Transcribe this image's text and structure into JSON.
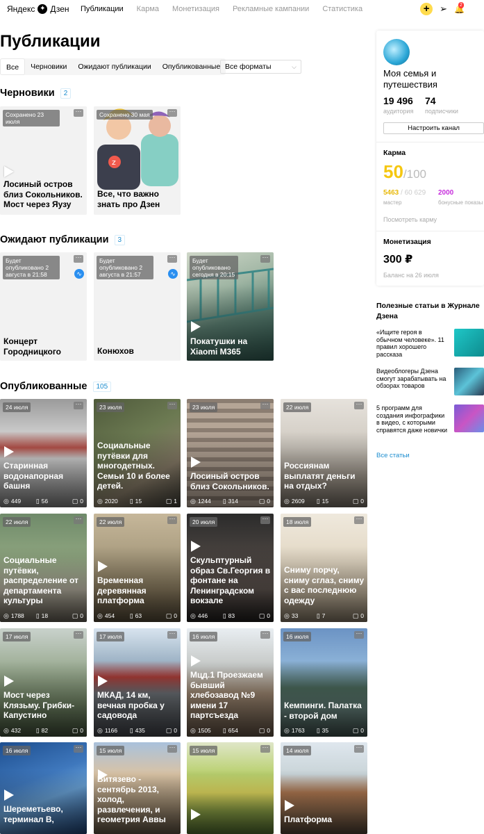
{
  "header": {
    "logo_text": "Яндекс",
    "logo_brand": "Дзен",
    "nav": [
      "Публикации",
      "Карма",
      "Монетизация",
      "Рекламные кампании",
      "Статистика"
    ],
    "add_label": "+",
    "notifications_count": "2"
  },
  "page_title": "Публикации",
  "filters": {
    "tabs": [
      "Все",
      "Черновики",
      "Ожидают публикации",
      "Опубликованные"
    ],
    "format_select": "Все форматы"
  },
  "sections": {
    "drafts": {
      "title": "Черновики",
      "count": "2"
    },
    "scheduled": {
      "title": "Ожидают публикации",
      "count": "3"
    },
    "published": {
      "title": "Опубликованные",
      "count": "105"
    }
  },
  "drafts": [
    {
      "badge": "Сохранено 23 июля",
      "title": "Лосиный остров близ Сокольников. Мост через Яузу"
    },
    {
      "badge": "Сохранено 30 мая",
      "title": "Все, что важно знать про Дзен"
    }
  ],
  "scheduled": [
    {
      "badge": "Будет опубликовано 2 августа в 21:58",
      "title": "Концерт Городницкого"
    },
    {
      "badge": "Будет опубликовано 2 августа в 21:57",
      "title": "Конюхов"
    },
    {
      "badge": "Будет опубликовано сегодня в 20:15",
      "title": "Покатушки на Xiaomi M365"
    }
  ],
  "published": [
    {
      "date": "24 июля",
      "title": "Старинная водонапорная башня",
      "views": "449",
      "reads": "56",
      "comments": "0"
    },
    {
      "date": "23 июля",
      "title": "Социальные путёвки для многодетных. Семьи 10 и более детей.",
      "views": "2020",
      "reads": "15",
      "comments": "1"
    },
    {
      "date": "23 июля",
      "title": "Лосиный остров близ Сокольников.",
      "views": "1244",
      "reads": "314",
      "comments": "0"
    },
    {
      "date": "22 июля",
      "title": "Россиянам выплатят деньги на отдых?",
      "views": "2609",
      "reads": "15",
      "comments": "0"
    },
    {
      "date": "22 июля",
      "title": "Социальные путёвки, распределение от департамента культуры",
      "views": "1788",
      "reads": "18",
      "comments": "0"
    },
    {
      "date": "22 июля",
      "title": "Временная деревянная платформа",
      "views": "454",
      "reads": "63",
      "comments": "0"
    },
    {
      "date": "20 июля",
      "title": "Скульптурный образ Св.Георгия в фонтане на Ленинградском вокзале",
      "views": "446",
      "reads": "83",
      "comments": "0"
    },
    {
      "date": "18 июля",
      "title": "Сниму порчу, сниму сглаз, сниму с вас последнюю одежду",
      "views": "33",
      "reads": "7",
      "comments": "0"
    },
    {
      "date": "17 июля",
      "title": "Мост через Клязьму. Грибки-Капустино",
      "views": "432",
      "reads": "82",
      "comments": "0"
    },
    {
      "date": "17 июля",
      "title": "МКАД, 14 км, вечная пробка у садовода",
      "views": "1166",
      "reads": "435",
      "comments": "0"
    },
    {
      "date": "16 июля",
      "title": "Мцд.1 Проезжаем бывший хлебозавод №9 имени 17 партсъезда",
      "views": "1505",
      "reads": "654",
      "comments": "0"
    },
    {
      "date": "16 июля",
      "title": "Кемпинги. Палатка - второй дом",
      "views": "1763",
      "reads": "35",
      "comments": "0"
    },
    {
      "date": "16 июля",
      "title": "Шереметьево, терминал B,"
    },
    {
      "date": "15 июля",
      "title": "Витязево - сентябрь 2013, холод, развлечения, и геометрия Аввы"
    },
    {
      "date": "15 июля",
      "title": ""
    },
    {
      "date": "14 июля",
      "title": "Платформа"
    }
  ],
  "channel": {
    "name": "Моя семья и путешествия",
    "audience": "19 496",
    "audience_label": "аудитория",
    "subscribers": "74",
    "subscribers_label": "подписчики",
    "settings_button": "Настроить канал"
  },
  "karma": {
    "heading": "Карма",
    "value": "50",
    "max": "/100",
    "master_value": "5463",
    "master_total": " / 60 629",
    "master_label": "мастер",
    "bonus_value": "2000",
    "bonus_label": "бонусные показы",
    "link": "Посмотреть карму"
  },
  "monetization": {
    "heading": "Монетизация",
    "value": "300 ₽",
    "balance_label": "Баланс на 26 июля"
  },
  "useful": {
    "heading": "Полезные статьи в Журнале Дзена",
    "articles": [
      "«Ищите героя в обычном человеке». 11 правил хорошего рассказа",
      "Видеоблогеры Дзена смогут зарабатывать на обзорах товаров",
      "5 программ для создания инфографики в видео, с которыми справятся даже новички"
    ],
    "all_link": "Все статьи"
  },
  "colors": {
    "accent_yellow": "#f5c711",
    "link_blue": "#1a8ccf",
    "bonus_purple": "#c62edc"
  }
}
